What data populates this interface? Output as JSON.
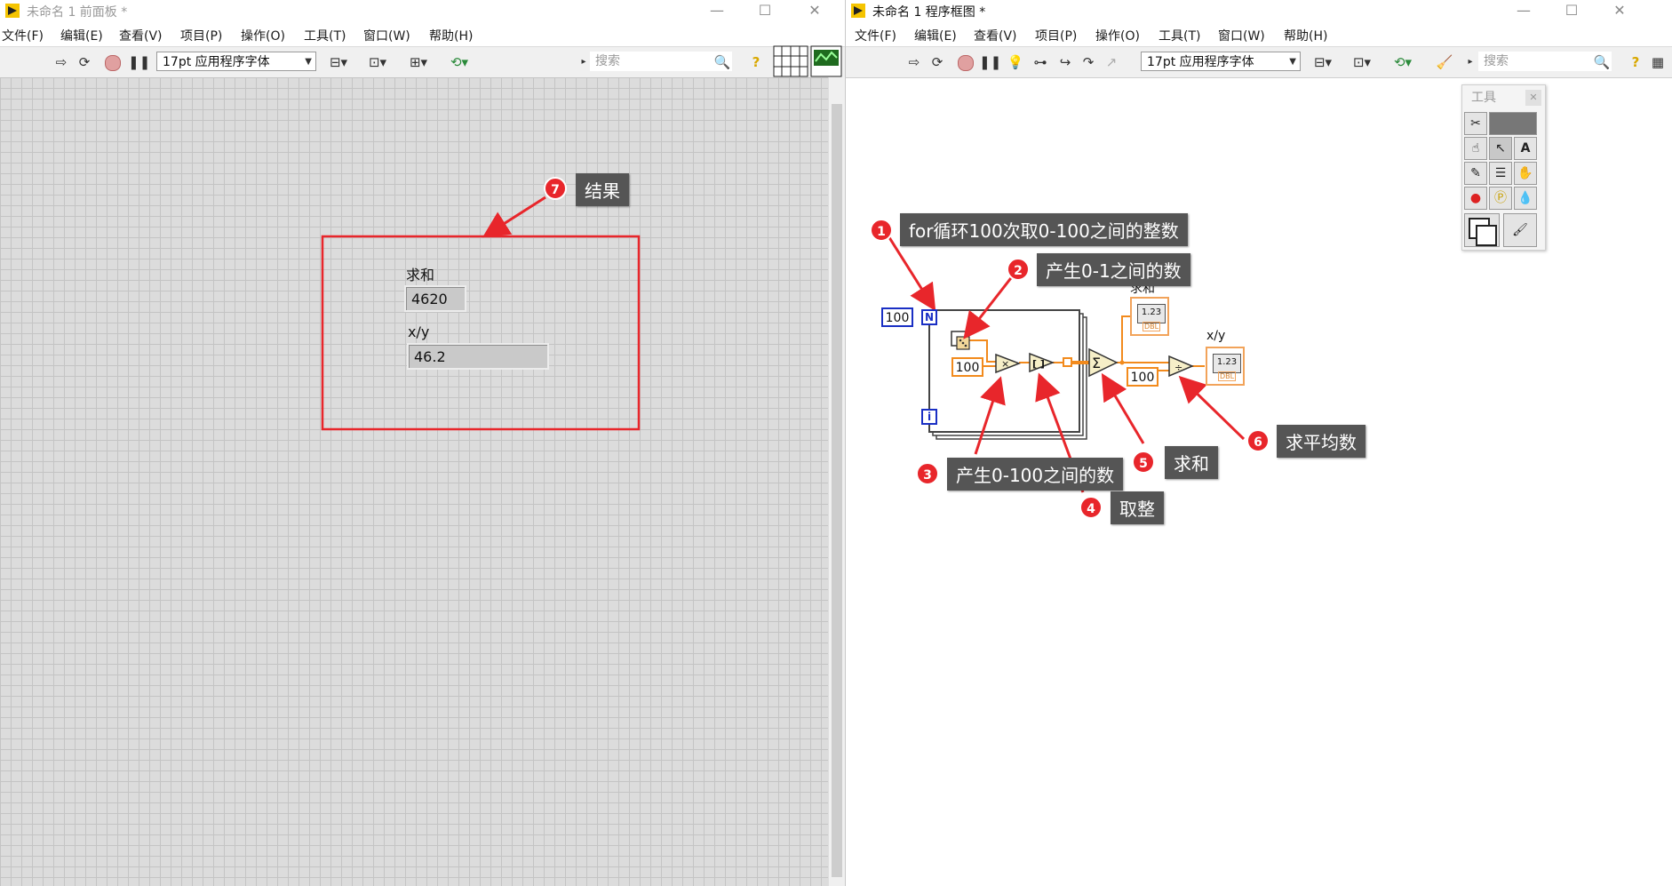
{
  "front_panel": {
    "title": "未命名 1 前面板 *",
    "menu": [
      "文件(F)",
      "编辑(E)",
      "查看(V)",
      "项目(P)",
      "操作(O)",
      "工具(T)",
      "窗口(W)",
      "帮助(H)"
    ],
    "font_select": "17pt 应用程序字体",
    "search_placeholder": "搜索",
    "callout_7": {
      "badge": "7",
      "text": "结果"
    },
    "indicators": [
      {
        "label": "求和",
        "value": "4620"
      },
      {
        "label": "x/y",
        "value": "46.2"
      }
    ]
  },
  "block_diagram": {
    "title": "未命名 1 程序框图 *",
    "menu": [
      "文件(F)",
      "编辑(E)",
      "查看(V)",
      "项目(P)",
      "操作(O)",
      "工具(T)",
      "窗口(W)",
      "帮助(H)"
    ],
    "font_select": "17pt 应用程序字体",
    "search_placeholder": "搜索",
    "tools_palette_title": "工具",
    "loop_count": "100",
    "loop_n": "N",
    "loop_i": "i",
    "multiply_const": "100",
    "divide_const": "100",
    "sum_label": "求和",
    "xy_label": "x/y",
    "dbl_display": "1.23",
    "dbl_tag": "DBL",
    "callouts": [
      {
        "badge": "1",
        "text": "for循环100次取0-100之间的整数"
      },
      {
        "badge": "2",
        "text": "产生0-1之间的数"
      },
      {
        "badge": "3",
        "text": "产生0-100之间的数"
      },
      {
        "badge": "4",
        "text": "取整"
      },
      {
        "badge": "5",
        "text": "求和"
      },
      {
        "badge": "6",
        "text": "求平均数"
      }
    ]
  },
  "colors": {
    "annotation_red": "#e8262b",
    "callout_bg": "#555555",
    "wire_orange": "#f28a1c",
    "loop_blue": "#1a2fc4"
  }
}
